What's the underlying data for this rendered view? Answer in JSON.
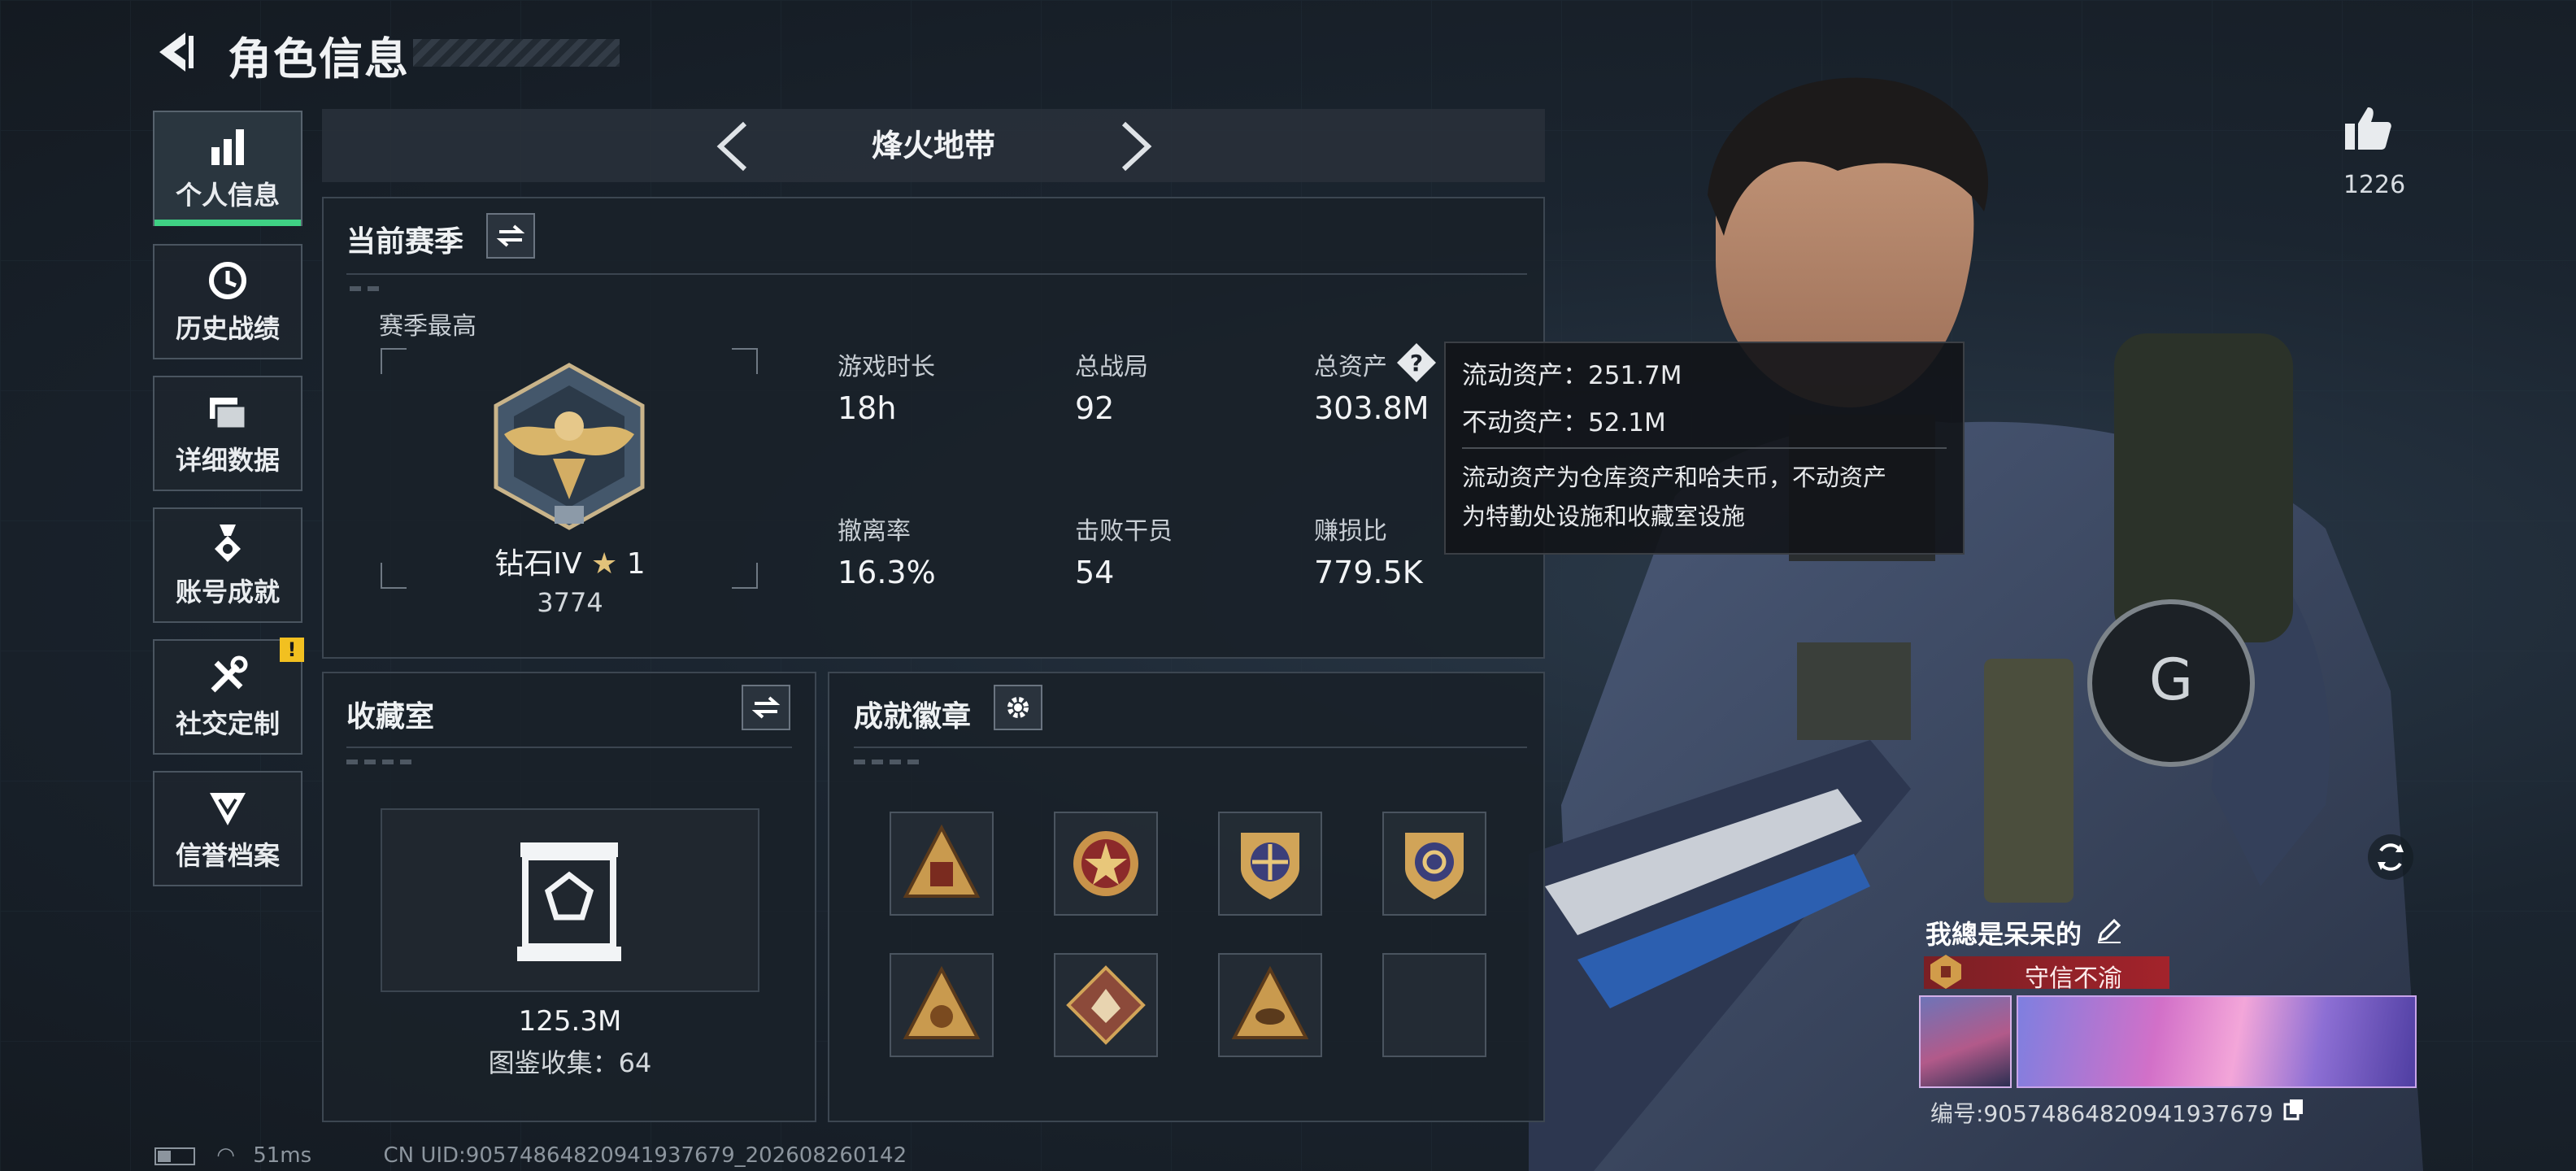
{
  "header": {
    "title": "角色信息"
  },
  "sidebar": {
    "items": [
      {
        "label": "个人信息",
        "icon": "bar-chart-icon",
        "active": true
      },
      {
        "label": "历史战绩",
        "icon": "history-clock-icon"
      },
      {
        "label": "详细数据",
        "icon": "folders-icon"
      },
      {
        "label": "账号成就",
        "icon": "medal-icon"
      },
      {
        "label": "社交定制",
        "icon": "tools-icon",
        "badge": "!"
      },
      {
        "label": "信誉档案",
        "icon": "credit-shield-icon"
      }
    ]
  },
  "mode": {
    "name": "烽火地带"
  },
  "season": {
    "header": "当前赛季",
    "best_label": "赛季最高",
    "rank_name": "钻石IV",
    "rank_stars": "1",
    "rank_points": "3774",
    "stats": [
      {
        "label": "游戏时长",
        "value": "18h"
      },
      {
        "label": "总战局",
        "value": "92"
      },
      {
        "label": "总资产",
        "value": "303.8M"
      },
      {
        "label": "撤离率",
        "value": "16.3%"
      },
      {
        "label": "击败干员",
        "value": "54"
      },
      {
        "label": "赚损比",
        "value": "779.5K"
      }
    ]
  },
  "tooltip": {
    "liquid": "流动资产：251.7M",
    "fixed": "不动资产：52.1M",
    "desc_line1": "流动资产为仓库资产和哈夫币，不动资产",
    "desc_line2": "为特勤处设施和收藏室设施"
  },
  "collection": {
    "header": "收藏室",
    "value": "125.3M",
    "collected": "图鉴收集：64"
  },
  "achievements": {
    "header": "成就徽章",
    "badges": [
      "gold-triangle",
      "star-medal",
      "compass-shield",
      "wheel-shield",
      "bag-triangle",
      "wolf-diamond",
      "eye-triangle",
      "empty"
    ]
  },
  "likes": {
    "count": "1226"
  },
  "profile": {
    "name": "我總是呆呆的",
    "title_tag": "守信不渝",
    "uid_line": "编号:90574864820941937679"
  },
  "footer": {
    "ping": "51ms",
    "uid_text": "CN UID:90574864820941937679_202608260142"
  },
  "colors": {
    "accent_green": "#3fd184",
    "warn_yellow": "#f2c020",
    "title_tag_red": "#a3232b"
  }
}
